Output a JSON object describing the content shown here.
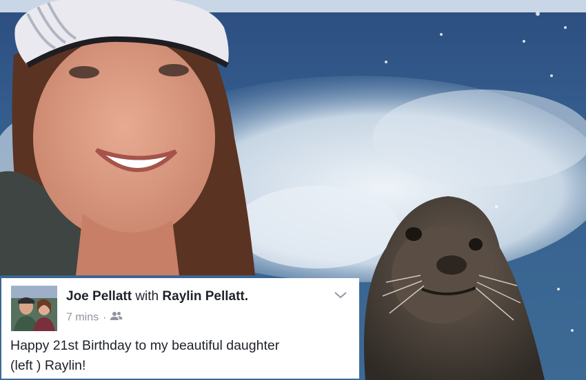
{
  "post": {
    "author": "Joe Pellatt",
    "with_word": "with",
    "tagged": "Raylin Pellatt.",
    "timestamp": "7 mins",
    "separator": "·",
    "audience_icon": "friends-icon",
    "menu_icon": "chevron-down-icon",
    "text_line1": "Happy 21st Birthday to my beautiful daughter",
    "text_line2": "(left ) Raylin!"
  },
  "photo": {
    "subject": "woman in white cap and a sea lion on a boat wake",
    "colors": {
      "sea": "#2f5584",
      "foam": "#dce6ef",
      "skin": "#d99a82",
      "hair": "#5a3322",
      "sealion": "#4a4038",
      "cap": "#e9e9ef"
    }
  },
  "colors": {
    "text": "#1d2129",
    "meta": "#90949c",
    "card": "#ffffff"
  }
}
